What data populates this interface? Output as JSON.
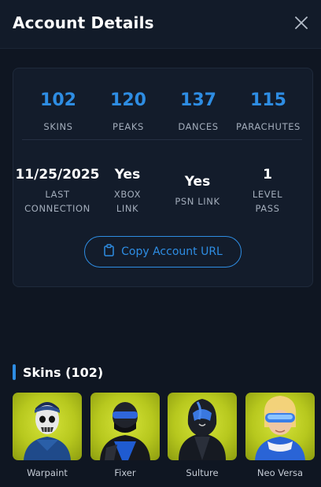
{
  "header": {
    "title": "Account Details"
  },
  "stats": [
    {
      "value": "102",
      "label": "SKINS"
    },
    {
      "value": "120",
      "label": "PEAKS"
    },
    {
      "value": "137",
      "label": "DANCES"
    },
    {
      "value": "115",
      "label": "PARACHUTES"
    }
  ],
  "info": [
    {
      "value": "11/25/2025",
      "label_line1": "LAST",
      "label_line2": "CONNECTION"
    },
    {
      "value": "Yes",
      "label_line1": "XBOX",
      "label_line2": "LINK"
    },
    {
      "value": "Yes",
      "label_line1": "PSN LINK",
      "label_line2": ""
    },
    {
      "value": "1",
      "label_line1": "LEVEL",
      "label_line2": "PASS"
    }
  ],
  "copy_button": {
    "label": "Copy Account URL"
  },
  "skins_section": {
    "title": "Skins (102)"
  },
  "skins": [
    {
      "name": "Warpaint"
    },
    {
      "name": "Fixer"
    },
    {
      "name": "Sulture"
    },
    {
      "name": "Neo Versa"
    }
  ],
  "colors": {
    "accent": "#2e8de3",
    "background": "#0f1622",
    "card": "#131c2b",
    "skin_bg": "#c4d52a"
  }
}
